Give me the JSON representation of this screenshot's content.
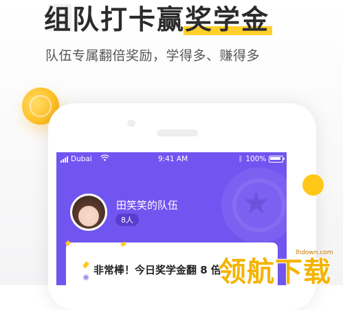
{
  "headline": {
    "text_plain": "组队打卡赢",
    "text_highlight": "奖学金"
  },
  "subline": "队伍专属翻倍奖励，学得多、赚得多",
  "status_bar": {
    "carrier": "Dubai",
    "time": "9:41 AM",
    "battery": "100%"
  },
  "team": {
    "name": "田笑笑的队伍",
    "members": "8人"
  },
  "card": {
    "message": "非常棒！今日奖学金翻 8 倍"
  },
  "watermark": {
    "text": "领航下载",
    "url": "lhdown.com"
  },
  "colors": {
    "brand_purple": "#7155f0",
    "accent_yellow": "#ffc819",
    "highlight_yellow": "#ffcf2c"
  },
  "icons": [
    "signal-icon",
    "wifi-icon",
    "bluetooth-icon",
    "battery-icon",
    "medal-star-icon",
    "spinner-icon",
    "coin-icon"
  ]
}
